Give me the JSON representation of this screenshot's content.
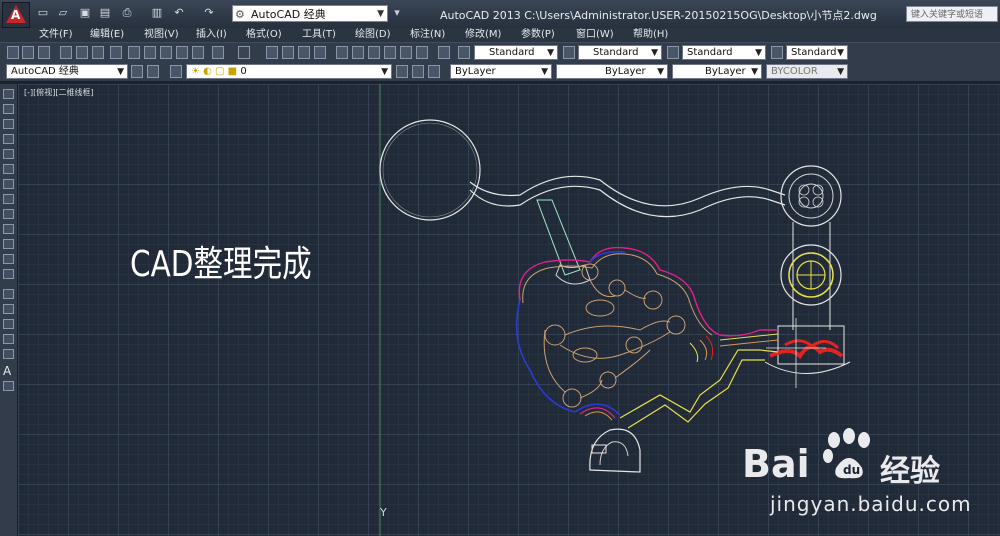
{
  "title_bar": {
    "app_letter": "A",
    "workspace": "AutoCAD 经典",
    "window_title": "AutoCAD 2013    C:\\Users\\Administrator.USER-20150215OG\\Desktop\\小节点2.dwg",
    "search_placeholder": "键入关键字或短语"
  },
  "menu": {
    "items": [
      "文件(F)",
      "编辑(E)",
      "视图(V)",
      "插入(I)",
      "格式(O)",
      "工具(T)",
      "绘图(D)",
      "标注(N)",
      "修改(M)",
      "参数(P)",
      "窗口(W)",
      "帮助(H)"
    ]
  },
  "toolbar1": {
    "text_style": "Standard",
    "dim_style": "Standard",
    "table_style": "Standard",
    "mleader_style": "Standard"
  },
  "toolbar2": {
    "workspace": "AutoCAD 经典",
    "layer": "0",
    "color": "ByLayer",
    "linetype": "ByLayer",
    "lineweight": "ByLayer",
    "plotstyle": "BYCOLOR"
  },
  "viewport": {
    "label": "[-][俯视][二维线框]"
  },
  "canvas": {
    "overlay_text": "CAD整理完成",
    "ucs_y": "Y"
  },
  "watermark": {
    "bai": "Bai",
    "du_icon": "paw-icon",
    "jingyan": "经验",
    "url": "jingyan.baidu.com"
  },
  "colors": {
    "grid_bg": "#212a38",
    "accent_red": "#c8282a",
    "drawing_white": "#e8e8e8",
    "yellow": "#e6e04a",
    "blue": "#2a3bd8",
    "magenta": "#e0208a",
    "orange": "#d99a4a",
    "tan": "#caa070"
  }
}
